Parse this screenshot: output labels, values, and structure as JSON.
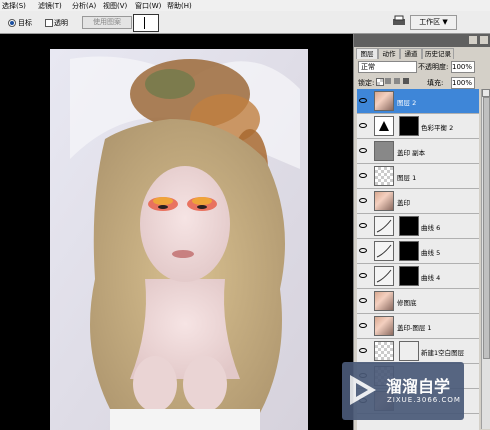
{
  "menubar": {
    "items": [
      "选择(S)",
      "滤镜(T)",
      "分析(A)",
      "视图(V)",
      "窗口(W)",
      "帮助(H)"
    ]
  },
  "options": {
    "radio_target": "目标",
    "check_transparent": "透明",
    "use_pattern": "使用图案",
    "workspace": "工作区 ▼"
  },
  "panel": {
    "tabs": [
      "图层",
      "动作",
      "通道",
      "历史记录"
    ],
    "blend_mode": "正常",
    "opacity_label": "不透明度:",
    "opacity_value": "100%",
    "lock_label": "锁定:",
    "fill_label": "填充:",
    "fill_value": "100%",
    "layers": [
      {
        "name": "图层 2",
        "selected": true
      },
      {
        "name": "色彩平衡 2",
        "selected": false
      },
      {
        "name": "盖印 副本",
        "selected": false
      },
      {
        "name": "图层 1",
        "selected": false
      },
      {
        "name": "盖印",
        "selected": false
      },
      {
        "name": "曲线 6",
        "selected": false
      },
      {
        "name": "曲线 5",
        "selected": false
      },
      {
        "name": "曲线 4",
        "selected": false
      },
      {
        "name": "修图底",
        "selected": false
      },
      {
        "name": "盖印-图层 1",
        "selected": false
      },
      {
        "name": "新建1空白图层",
        "selected": false
      }
    ]
  },
  "watermark": {
    "title": "溜溜自学",
    "url": "ZIXUE.3066.COM"
  },
  "colors": {
    "selected_layer": "#3e86d8",
    "watermark_bg": "#4a5a78"
  }
}
